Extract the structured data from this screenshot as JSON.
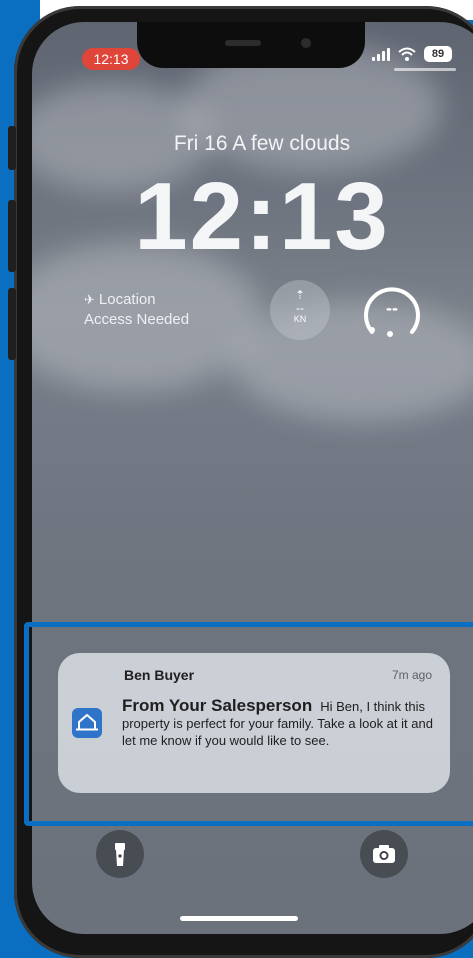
{
  "status_bar": {
    "time": "12:13",
    "battery": "89"
  },
  "lockscreen": {
    "date_line": "Fri 16  A few clouds",
    "clock": "12:13",
    "location_widget": {
      "line1": "Location",
      "line2": "Access Needed"
    },
    "wind_widget": {
      "value": "--",
      "unit": "KN"
    },
    "uv_widget": {
      "value": "--"
    }
  },
  "notification": {
    "sender": "Ben Buyer",
    "time": "7m ago",
    "title": "From Your  Salesperson",
    "message": "Hi Ben, I think this property is perfect for your family. Take a look at it and let me know if you would like to see.",
    "app_icon": "house-icon"
  },
  "controls": {
    "left": "flashlight-icon",
    "right": "camera-icon"
  },
  "colors": {
    "accent_blue": "#0a6fc0",
    "recording_pill": "#e0453a",
    "app_icon_bg": "#2f74c8"
  }
}
